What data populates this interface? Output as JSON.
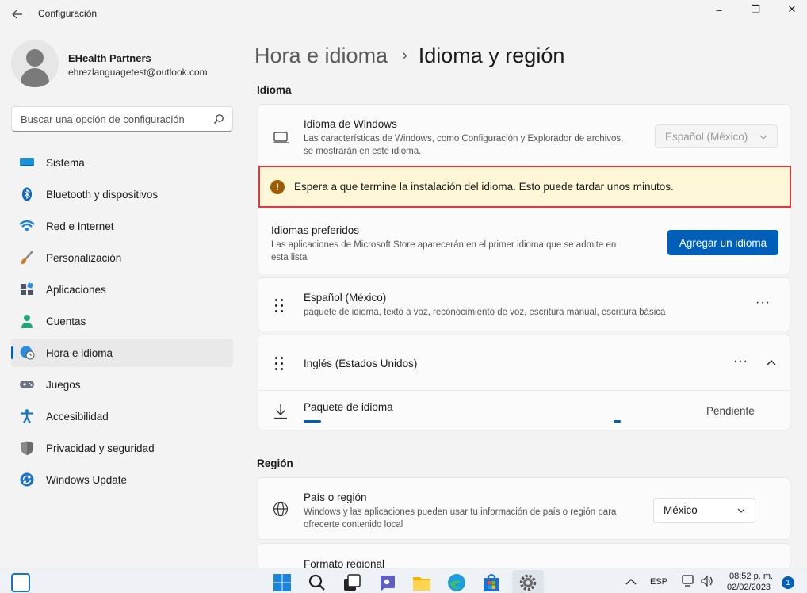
{
  "window": {
    "back_icon": "arrow-left-icon",
    "title": "Configuración",
    "controls": {
      "minimize": "–",
      "maximize": "❐",
      "close": "✕"
    }
  },
  "profile": {
    "name": "EHealth Partners",
    "email": "ehrezlanguagetest@outlook.com"
  },
  "search": {
    "placeholder": "Buscar una opción de configuración",
    "icon": "search-icon"
  },
  "sidebar": {
    "items": [
      {
        "label": "Sistema",
        "icon": "monitor-icon",
        "color": "#1f8fd6"
      },
      {
        "label": "Bluetooth y dispositivos",
        "icon": "bluetooth-icon",
        "color": "#0a64c2"
      },
      {
        "label": "Red e Internet",
        "icon": "wifi-icon",
        "color": "#1c84d8"
      },
      {
        "label": "Personalización",
        "icon": "brush-icon",
        "color": "#d47a1e"
      },
      {
        "label": "Aplicaciones",
        "icon": "apps-icon",
        "color": "#4a5666"
      },
      {
        "label": "Cuentas",
        "icon": "person-icon",
        "color": "#1fa67a"
      },
      {
        "label": "Hora e idioma",
        "icon": "globe-clock-icon",
        "color": "#2b8ce0",
        "active": true
      },
      {
        "label": "Juegos",
        "icon": "gamepad-icon",
        "color": "#6b7280"
      },
      {
        "label": "Accesibilidad",
        "icon": "accessibility-icon",
        "color": "#1979c8"
      },
      {
        "label": "Privacidad y seguridad",
        "icon": "shield-icon",
        "color": "#6b6b6b"
      },
      {
        "label": "Windows Update",
        "icon": "update-icon",
        "color": "#1a73c9"
      }
    ]
  },
  "breadcrumb": {
    "parent": "Hora e idioma",
    "separator": "›",
    "current": "Idioma y región"
  },
  "idioma": {
    "section_title": "Idioma",
    "windows_language": {
      "title": "Idioma de Windows",
      "desc_line1": "Las características de Windows, como Configuración y Explorador de archivos,",
      "desc_line2": "se mostrarán en este idioma.",
      "value": "Español (México)",
      "icon": "laptop-icon"
    },
    "warning": {
      "icon": "warning-icon",
      "text": "Espera a que termine la instalación del idioma. Esto puede tardar unos minutos.",
      "highlight_color": "#e0383a"
    },
    "preferred": {
      "title": "Idiomas preferidos",
      "desc_line1": "Las aplicaciones de Microsoft Store aparecerán en el primer idioma que se admite en",
      "desc_line2": "esta lista",
      "button": "Agregar un idioma"
    },
    "languages": [
      {
        "name": "Español (México)",
        "desc": "paquete de idioma, texto a voz, reconocimiento de voz, escritura manual, escritura básica",
        "more": "···"
      },
      {
        "name": "Inglés (Estados Unidos)",
        "more": "···",
        "expand_icon": "chevron-up-icon",
        "pack": {
          "title": "Paquete de idioma",
          "status": "Pendiente",
          "icon": "download-icon"
        }
      }
    ]
  },
  "region": {
    "section_title": "Región",
    "country": {
      "title": "País o región",
      "desc_line1": "Windows y las aplicaciones pueden usar tu información de país o región para",
      "desc_line2": "ofrecerte contenido local",
      "value": "México",
      "icon": "globe-icon"
    },
    "format": {
      "title": "Formato regional"
    }
  },
  "taskbar": {
    "lang": "ESP",
    "time": "08:52 p. m.",
    "date": "02/02/2023",
    "notifications": "1"
  },
  "colors": {
    "accent": "#005fb8",
    "warning_bg": "#fdf6d7",
    "warning_icon": "#9d5d00"
  }
}
